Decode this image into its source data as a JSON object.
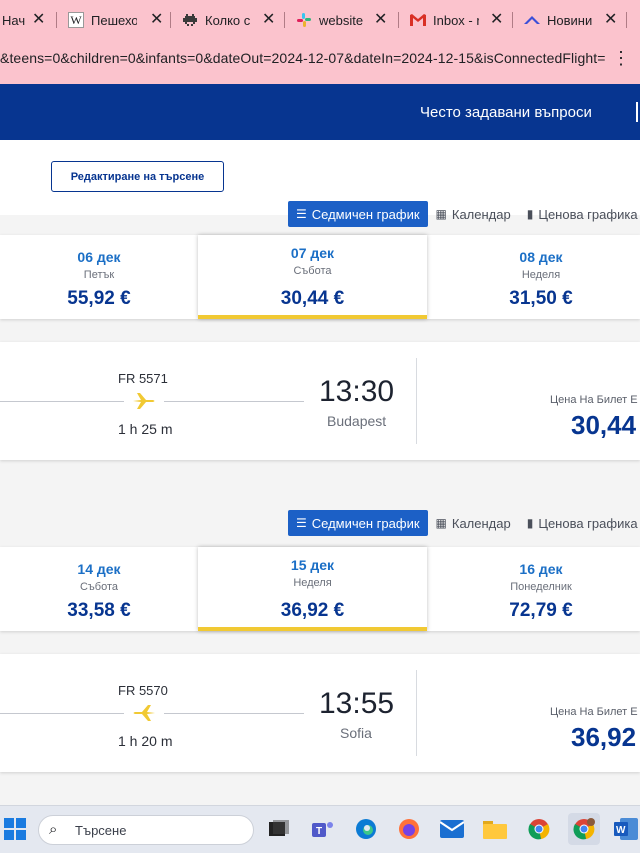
{
  "browser": {
    "tabs": [
      {
        "label": "Нач",
        "icon": "home-page-icon"
      },
      {
        "label": "Пешехо",
        "icon": "wikipedia-icon"
      },
      {
        "label": "Колко с",
        "icon": "invader-icon"
      },
      {
        "label": "website",
        "icon": "slack-icon"
      },
      {
        "label": "Inbox - r",
        "icon": "gmail-icon"
      },
      {
        "label": "Новини",
        "icon": "news-icon"
      }
    ],
    "close_glyph": "✕",
    "url": "&teens=0&children=0&infants=0&dateOut=2024-12-07&dateIn=2024-12-15&isConnectedFlight=f..."
  },
  "header": {
    "faq": "Често задавани въпроси"
  },
  "edit_search": "Редактиране на търсене",
  "view_tabs": {
    "weekly": "Седмичен график",
    "calendar": "Календар",
    "price": "Ценова графика"
  },
  "outbound": {
    "days": [
      {
        "date": "06 дек",
        "weekday": "Петък",
        "price": "55,92 €"
      },
      {
        "date": "07 дек",
        "weekday": "Събота",
        "price": "30,44 €",
        "selected": true
      },
      {
        "date": "08 дек",
        "weekday": "Неделя",
        "price": "31,50 €"
      }
    ],
    "flight": {
      "number": "FR 5571",
      "duration": "1 h 25 m",
      "arrival_time": "13:30",
      "arrival_city": "Budapest",
      "price_label": "Цена На Билет Е",
      "price": "30,44"
    }
  },
  "inbound": {
    "days": [
      {
        "date": "14 дек",
        "weekday": "Събота",
        "price": "33,58 €"
      },
      {
        "date": "15 дек",
        "weekday": "Неделя",
        "price": "36,92 €",
        "selected": true
      },
      {
        "date": "16 дек",
        "weekday": "Понеделник",
        "price": "72,79 €"
      }
    ],
    "flight": {
      "number": "FR 5570",
      "duration": "1 h 20 m",
      "arrival_time": "13:55",
      "arrival_city": "Sofia",
      "price_label": "Цена На Билет Е",
      "price": "36,92"
    }
  },
  "taskbar": {
    "search_placeholder": "Търсене"
  },
  "colors": {
    "brand": "#073590",
    "accent": "#f1c933",
    "link": "#1b6fc6"
  }
}
